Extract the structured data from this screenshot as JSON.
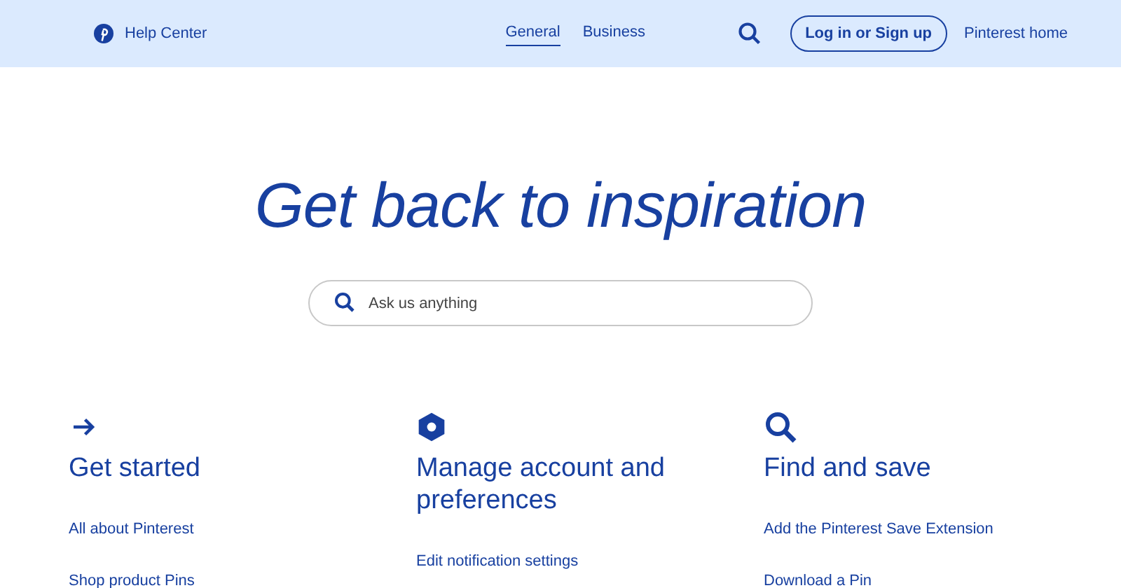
{
  "header": {
    "brand": "Help Center",
    "tabs": [
      {
        "label": "General",
        "selected": true
      },
      {
        "label": "Business",
        "selected": false
      }
    ],
    "login_button": "Log in or Sign up",
    "home_link": "Pinterest home"
  },
  "hero": {
    "title": "Get back to inspiration",
    "search": {
      "placeholder": "Ask us anything"
    }
  },
  "categories": [
    {
      "kind": "arrow",
      "title": "Get started",
      "links": [
        "All about Pinterest",
        "Shop product Pins"
      ]
    },
    {
      "kind": "hexagon",
      "title": "Manage account and preferences",
      "links": [
        "Edit notification settings"
      ]
    },
    {
      "kind": "search",
      "title": "Find and save",
      "links": [
        "Add the Pinterest Save Extension",
        "Download a Pin"
      ]
    }
  ]
}
